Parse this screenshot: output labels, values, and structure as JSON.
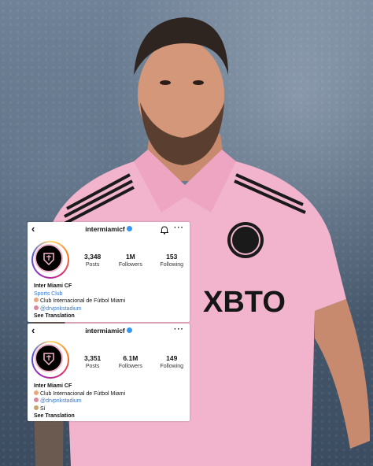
{
  "photo": {
    "jersey_text": "XBTO"
  },
  "card1": {
    "username": "intermiamicf",
    "posts_count": "3,348",
    "posts_label": "Posts",
    "followers_count": "1M",
    "followers_label": "Followers",
    "following_count": "153",
    "following_label": "Following",
    "name": "Inter Miami CF",
    "category": "Sports Club",
    "bio_line1": "Club Internacional de Fútbol Miami",
    "bio_line2": "@drvpnkstadium",
    "translation": "See Translation"
  },
  "card2": {
    "username": "intermiamicf",
    "posts_count": "3,351",
    "posts_label": "Posts",
    "followers_count": "6.1M",
    "followers_label": "Followers",
    "following_count": "149",
    "following_label": "Following",
    "name": "Inter Miami CF",
    "bio_line1": "Club Internacional de Fútbol Miami",
    "bio_line2": "@drvpnkstadium",
    "bio_line3": "Sí",
    "translation": "See Translation"
  },
  "colors": {
    "jersey_pink": "#f2b3cc",
    "verified_blue": "#3897f0",
    "link_blue": "#3a78c3"
  }
}
